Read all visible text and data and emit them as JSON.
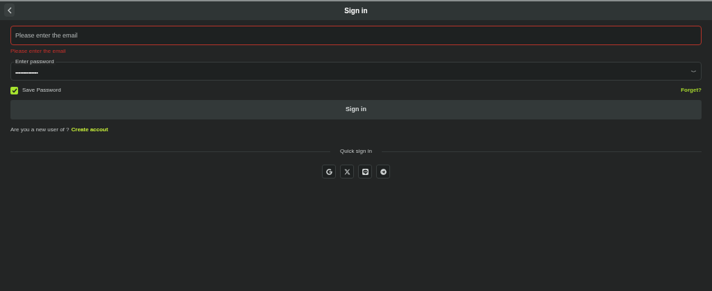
{
  "header": {
    "title": "Sign in"
  },
  "email": {
    "placeholder": "Please enter the email",
    "invalid": true,
    "error": "Please enter the email"
  },
  "password": {
    "label": "Enter password",
    "value": "••••••••••••••"
  },
  "save_password": {
    "label": "Save Password",
    "checked": true
  },
  "forgot_link": "Forget?",
  "submit_button": "Sign in",
  "signup": {
    "prompt": "Are you a new user of ?",
    "link": "Create accout"
  },
  "quick_sign_in": {
    "label": "Quick sign in",
    "providers": [
      {
        "kind": "google"
      },
      {
        "kind": "x"
      },
      {
        "kind": "line"
      },
      {
        "kind": "telegram"
      }
    ]
  }
}
